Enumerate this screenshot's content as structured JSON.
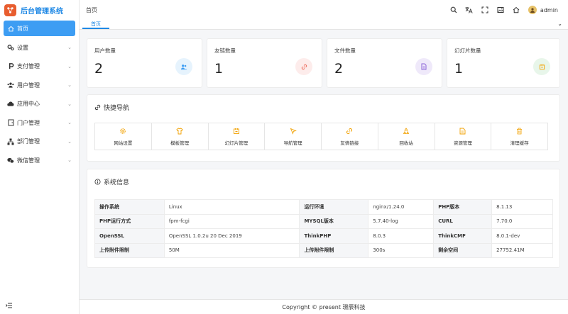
{
  "app": {
    "title": "后台管理系统"
  },
  "sidebar": {
    "items": [
      {
        "label": "首页",
        "icon": "home-icon",
        "active": true
      },
      {
        "label": "设置",
        "icon": "settings-icon"
      },
      {
        "label": "支付管理",
        "icon": "payment-icon"
      },
      {
        "label": "用户管理",
        "icon": "users-icon"
      },
      {
        "label": "应用中心",
        "icon": "cloud-icon"
      },
      {
        "label": "门户管理",
        "icon": "portal-icon"
      },
      {
        "label": "部门管理",
        "icon": "org-icon"
      },
      {
        "label": "微信管理",
        "icon": "wechat-icon"
      }
    ]
  },
  "header": {
    "breadcrumb": "首页",
    "username": "admin",
    "tools": [
      "search-icon",
      "translate-icon",
      "fullscreen-icon",
      "image-icon",
      "home-icon"
    ]
  },
  "tabs": {
    "items": [
      {
        "label": "首页"
      }
    ]
  },
  "stats": [
    {
      "label": "用户数量",
      "value": "2",
      "icon": "users-icon",
      "color": "#3d9df3",
      "bg": "#e6f3fd"
    },
    {
      "label": "友链数量",
      "value": "1",
      "icon": "link-icon",
      "color": "#ee6b5c",
      "bg": "#fdeceb"
    },
    {
      "label": "文件数量",
      "value": "2",
      "icon": "file-icon",
      "color": "#8b62d8",
      "bg": "#efe9fa"
    },
    {
      "label": "幻灯片数量",
      "value": "1",
      "icon": "slides-icon",
      "color": "#f2a100",
      "bg": "#e8f6ea"
    }
  ],
  "quicknav": {
    "title": "快捷导航",
    "items": [
      {
        "label": "网站设置",
        "icon": "gear-icon"
      },
      {
        "label": "模板管理",
        "icon": "shirt-icon"
      },
      {
        "label": "幻灯片管理",
        "icon": "slides-icon"
      },
      {
        "label": "导航管理",
        "icon": "cursor-icon"
      },
      {
        "label": "友情链接",
        "icon": "link-icon"
      },
      {
        "label": "回收站",
        "icon": "recycle-icon"
      },
      {
        "label": "资源管理",
        "icon": "document-icon"
      },
      {
        "label": "清理缓存",
        "icon": "trash-icon"
      }
    ]
  },
  "sysinfo": {
    "title": "系统信息",
    "rows": [
      [
        "操作系统",
        "Linux",
        "运行环境",
        "nginx/1.24.0",
        "PHP版本",
        "8.1.13"
      ],
      [
        "PHP运行方式",
        "fpm-fcgi",
        "MYSQL版本",
        "5.7.40-log",
        "CURL",
        "7.70.0"
      ],
      [
        "OpenSSL",
        "OpenSSL 1.0.2u 20 Dec 2019",
        "ThinkPHP",
        "8.0.3",
        "ThinkCMF",
        "8.0.1-dev"
      ],
      [
        "上传附件限制",
        "50M",
        "上传附件限制",
        "300s",
        "剩余空间",
        "27752.41M"
      ]
    ]
  },
  "footer": {
    "text": "Copyright © present  璟辰科技"
  },
  "colors": {
    "accent": "#1e88e5",
    "active_bg": "#3d9df3",
    "nav_icon": "#f2a100"
  }
}
